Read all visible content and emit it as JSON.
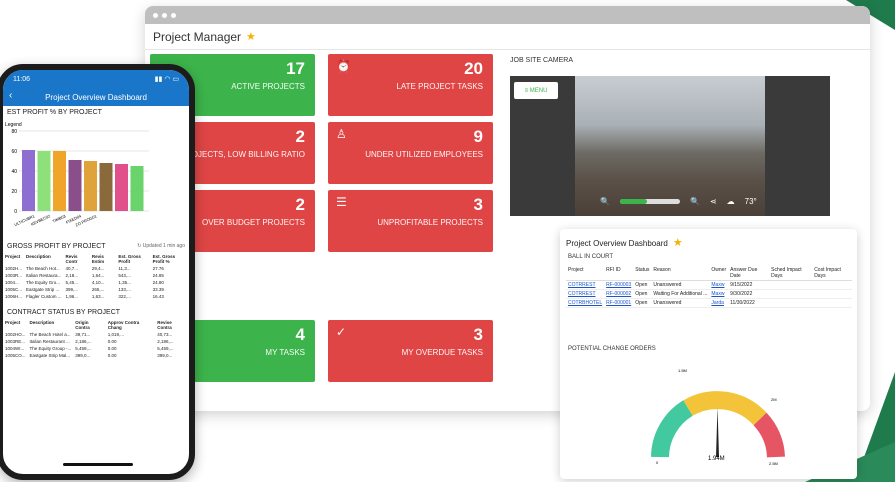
{
  "browser": {
    "title": "Project Manager",
    "tiles": [
      {
        "value": "17",
        "label": "ACTIVE PROJECTS",
        "color": "#3cb44b"
      },
      {
        "value": "20",
        "label": "LATE PROJECT TASKS",
        "color": "#e04545"
      },
      {
        "value": "2",
        "label": "PROJECTS, LOW BILLING RATIO",
        "color": "#e04545"
      },
      {
        "value": "9",
        "label": "UNDER UTILIZED EMPLOYEES",
        "color": "#e04545"
      },
      {
        "value": "2",
        "label": "OVER BUDGET PROJECTS",
        "color": "#e04545"
      },
      {
        "value": "3",
        "label": "UNPROFITABLE PROJECTS",
        "color": "#e04545"
      },
      {
        "value": "4",
        "label": "MY TASKS",
        "color": "#3cb44b"
      },
      {
        "value": "3",
        "label": "MY OVERDUE TASKS",
        "color": "#e04545"
      }
    ],
    "camera": {
      "title": "JOB SITE CAMERA",
      "menu": "≡ MENU",
      "temp": "73°",
      "zoom_level": 0.45
    }
  },
  "overview": {
    "title": "Project Overview Dashboard",
    "ball_in_court": "BALL IN COURT",
    "columns": [
      "Project",
      "RFI ID",
      "Status",
      "Reason",
      "Owner",
      "Answer Due Date",
      "Sched Impact Days",
      "Cost Impact Days"
    ],
    "rows": [
      {
        "project": "COTRREST",
        "rfi": "RF-000003",
        "status": "Open",
        "reason": "Unanswered",
        "owner": "Maxw",
        "due": "9/15/2022"
      },
      {
        "project": "COTRREST",
        "rfi": "RF-000002",
        "status": "Open",
        "reason": "Waiting For Additional ...",
        "owner": "Maxw",
        "due": "9/30/2022"
      },
      {
        "project": "COTRBHOTEL",
        "rfi": "RF-000001",
        "status": "Open",
        "reason": "Unanswered",
        "owner": "Jarda",
        "due": "11/30/2022"
      }
    ],
    "potential": "POTENTIAL CHANGE ORDERS",
    "gauge": {
      "value": "1.94M",
      "min": "0",
      "max": "2.5M",
      "t1": "1.5M",
      "t2": "2M"
    }
  },
  "phone": {
    "time": "11:06",
    "header": "Project Overview Dashboard",
    "est_title": "EST PROFIT % BY PROJECT",
    "legend": "Legend",
    "gross_title": "GROSS PROFIT BY PROJECT",
    "updated": "Updated 1 min ago",
    "gross_cols": [
      "Project",
      "Description",
      "Revis Contr",
      "Revis Estim",
      "Est. Gross Profit",
      "Est. Gross Profit %"
    ],
    "gross_rows": [
      [
        "1002H...",
        "The Beach Hot...",
        "40,7...",
        "29,4...",
        "11,3...",
        "27.76"
      ],
      [
        "1003R...",
        "Italian Restaura...",
        "2,18...",
        "1,64...",
        "543,...",
        "24.85"
      ],
      [
        "1004...",
        "The Equity Gro...",
        "5,45...",
        "4,10...",
        "1,35...",
        "24.80"
      ],
      [
        "1005C...",
        "Eastgate Strip ...",
        "399,...",
        "265,...",
        "133,...",
        "33.39"
      ],
      [
        "1006H...",
        "Flagler Custom ...",
        "1,96...",
        "1,63...",
        "322,...",
        "16.43"
      ]
    ],
    "contract_title": "CONTRACT STATUS BY PROJECT",
    "contract_cols": [
      "Project",
      "Description",
      "Origin Contra",
      "Approv Contra Chang",
      "Revise Contra"
    ],
    "contract_rows": [
      [
        "1002HO...",
        "The Beach Hotel a...",
        "39,71...",
        "1,019,...",
        "40,73..."
      ],
      [
        "1003RE...",
        "Italian Restaurant ...",
        "2,186,...",
        "0.00",
        "2,186,..."
      ],
      [
        "1004WI...",
        "The Equity Group -...",
        "5,459,...",
        "0.00",
        "5,459,..."
      ],
      [
        "1005CO...",
        "Eastgate Strip Mal...",
        "399,0...",
        "0.00",
        "399,0..."
      ]
    ]
  },
  "chart_data": {
    "type": "bar",
    "title": "EST PROFIT % BY PROJECT",
    "categories": [
      "ULTICUBR1",
      "KEVBEC02",
      "TIMB03",
      "FIXED04",
      "ZO PROG01",
      "",
      "",
      ""
    ],
    "values": [
      61,
      60,
      60,
      51,
      50,
      48,
      47,
      45
    ],
    "colors": [
      "#8e6fd1",
      "#8ee07a",
      "#f0a52a",
      "#8a4f8a",
      "#e0a23a",
      "#8a6a3a",
      "#e0508a",
      "#6bd36b"
    ],
    "ylim": [
      0,
      80
    ],
    "yticks": [
      0,
      20,
      40,
      60,
      80
    ]
  }
}
